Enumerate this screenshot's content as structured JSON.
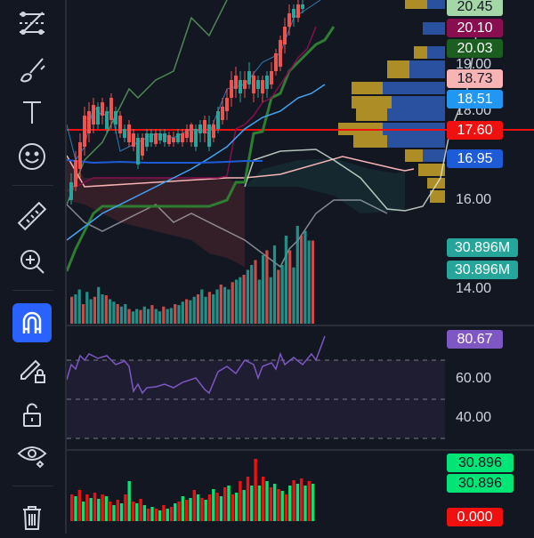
{
  "price_axis": {
    "ticks": [
      "19.00",
      "18.00",
      "16.00",
      "14.00"
    ],
    "badges": [
      {
        "value": "20.45",
        "color": "#a5d6a7",
        "text_color": "#131722"
      },
      {
        "value": "20.10",
        "color": "#880e4f",
        "text_color": "#ffffff"
      },
      {
        "value": "20.03",
        "color": "#1b5e20",
        "text_color": "#ffffff"
      },
      {
        "value": "18.73",
        "color": "#f8b4b4",
        "text_color": "#131722"
      },
      {
        "value": "18.51",
        "color": "#2196f3",
        "text_color": "#ffffff"
      },
      {
        "value": "17.60",
        "color": "#f01010",
        "text_color": "#ffffff"
      },
      {
        "value": "16.95",
        "color": "#1e5bd6",
        "text_color": "#ffffff"
      }
    ]
  },
  "volume_axis": {
    "badges": [
      {
        "value": "30.896M",
        "color": "#26a69a"
      },
      {
        "value": "30.896M",
        "color": "#26a69a"
      }
    ]
  },
  "rsi": {
    "value": "80.67",
    "badge_color": "#7e57c2",
    "ticks": [
      "60.00",
      "40.00"
    ],
    "levels": {
      "upper": 70,
      "lower": 30
    }
  },
  "volume_pane": {
    "badges": [
      {
        "value": "30.896",
        "color": "#00e676",
        "text_color": "#131722"
      },
      {
        "value": "30.896",
        "color": "#00e676",
        "text_color": "#131722"
      },
      {
        "value": "0.000",
        "color": "#f01010",
        "text_color": "#ffffff"
      }
    ]
  },
  "toolbar": {
    "tools": [
      {
        "name": "trend-line-tools-icon"
      },
      {
        "name": "brush-icon"
      },
      {
        "name": "text-tool-icon"
      },
      {
        "name": "emoji-icon"
      },
      {
        "name": "ruler-icon"
      },
      {
        "name": "zoom-in-icon"
      },
      {
        "name": "magnet-icon",
        "active": true
      },
      {
        "name": "lock-drawing-icon"
      },
      {
        "name": "lock-icon"
      },
      {
        "name": "eye-icon"
      },
      {
        "name": "trash-icon"
      }
    ]
  },
  "colors": {
    "up": "#26a69a",
    "down": "#ef5350",
    "vol_up": "#00e676",
    "vol_down": "#f01010",
    "current_price_line": "#f01010",
    "rsi_line": "#7e57c2"
  }
}
